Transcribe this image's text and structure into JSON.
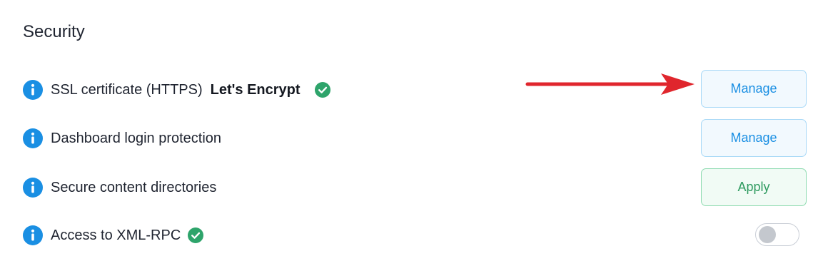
{
  "section": {
    "title": "Security"
  },
  "rows": [
    {
      "label": "SSL certificate (HTTPS)",
      "value": "Let's Encrypt",
      "status": "verified",
      "action_label": "Manage"
    },
    {
      "label": "Dashboard login protection",
      "action_label": "Manage"
    },
    {
      "label": "Secure content directories",
      "action_label": "Apply"
    },
    {
      "label": "Access to XML-RPC",
      "status": "verified",
      "toggle_on": false
    }
  ],
  "icons": {
    "info": "info-icon",
    "check": "check-circle-icon",
    "annotation": "red-arrow-icon"
  },
  "colors": {
    "info_blue": "#1a8fe3",
    "check_green": "#2ea46b",
    "manage_text": "#1a8fe3",
    "apply_text": "#2e9a5f",
    "arrow_red": "#e0262d"
  }
}
